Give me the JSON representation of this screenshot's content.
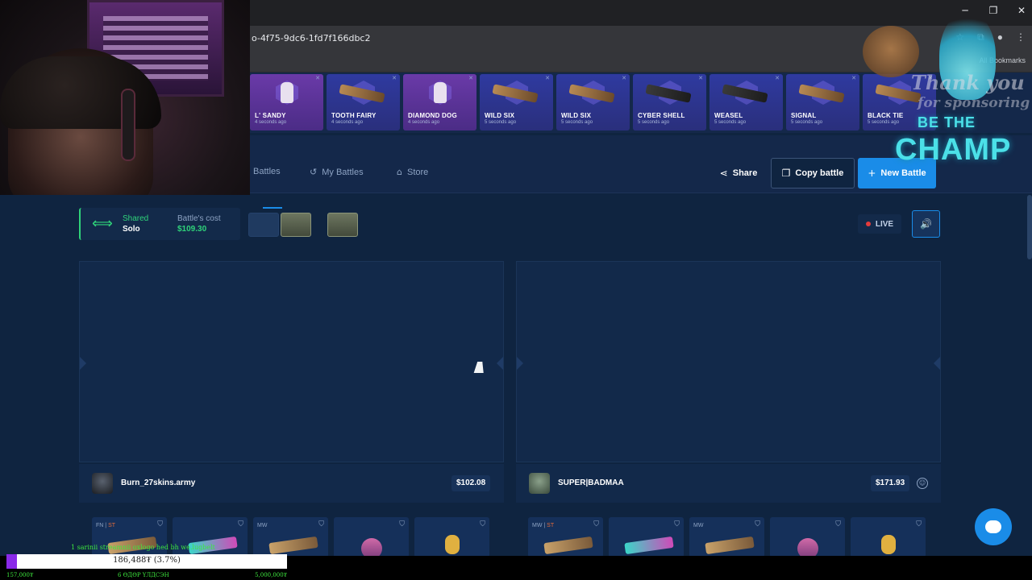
{
  "browser": {
    "url": "o-4f75-9dc6-1fd7f166dbc2",
    "all_bookmarks": "All Bookmarks",
    "window_controls": [
      "minimize-icon",
      "maximize-icon",
      "close-icon"
    ]
  },
  "live_drops": [
    {
      "name": "L' SANDY",
      "time": "4 seconds ago",
      "kind": "figure"
    },
    {
      "name": "TOOTH FAIRY",
      "time": "4 seconds ago",
      "kind": "gun"
    },
    {
      "name": "DIAMOND DOG",
      "time": "4 seconds ago",
      "kind": "figure"
    },
    {
      "name": "WILD SIX",
      "time": "5 seconds ago",
      "kind": "gun"
    },
    {
      "name": "WILD SIX",
      "time": "5 seconds ago",
      "kind": "gun"
    },
    {
      "name": "CYBER SHELL",
      "time": "5 seconds ago",
      "kind": "pistol"
    },
    {
      "name": "WEASEL",
      "time": "5 seconds ago",
      "kind": "pistol"
    },
    {
      "name": "SIGNAL",
      "time": "5 seconds ago",
      "kind": "gun"
    },
    {
      "name": "BLACK TIE",
      "time": "5 seconds ago",
      "kind": "gun"
    }
  ],
  "nav": {
    "battles": "Battles",
    "my_battles": "My Battles",
    "store": "Store",
    "share": "Share",
    "copy_battle": "Copy battle",
    "new_battle": "New Battle"
  },
  "mode": {
    "shared": "Shared",
    "solo": "Solo",
    "cost_label": "Battle's cost",
    "cost_value": "$109.30"
  },
  "live_label": "LIVE",
  "players": [
    {
      "name": "Burn_27skins.army",
      "value": "$102.08"
    },
    {
      "name": "SUPER|BADMAA",
      "value": "$171.93"
    }
  ],
  "items_left": [
    {
      "cond": "FN",
      "st": "ST",
      "art": "gun"
    },
    {
      "cond": "",
      "st": "",
      "art": "glove"
    },
    {
      "cond": "MW",
      "st": "",
      "art": "gun"
    },
    {
      "cond": "",
      "st": "",
      "art": "round"
    },
    {
      "cond": "",
      "st": "",
      "art": "charm"
    }
  ],
  "items_right": [
    {
      "cond": "MW",
      "st": "ST",
      "art": "gun"
    },
    {
      "cond": "",
      "st": "",
      "art": "glove"
    },
    {
      "cond": "MW",
      "st": "",
      "art": "gun"
    },
    {
      "cond": "",
      "st": "",
      "art": "round"
    },
    {
      "cond": "",
      "st": "",
      "art": "charm"
    }
  ],
  "overlay": {
    "thank": "Thank you",
    "sponsor": "for sponsoring me.",
    "be_the": "BE THE",
    "champ": "CHAMP"
  },
  "donation": {
    "message": "1 sarinii streamnii oxlogo hed bh we.lugbelt",
    "value": "186,488₮ (3.7%)",
    "progress": 0.037,
    "min": "157,000₮",
    "days": "6 ӨДӨР ҮЛДСЭН",
    "max": "5,000,000₮"
  }
}
